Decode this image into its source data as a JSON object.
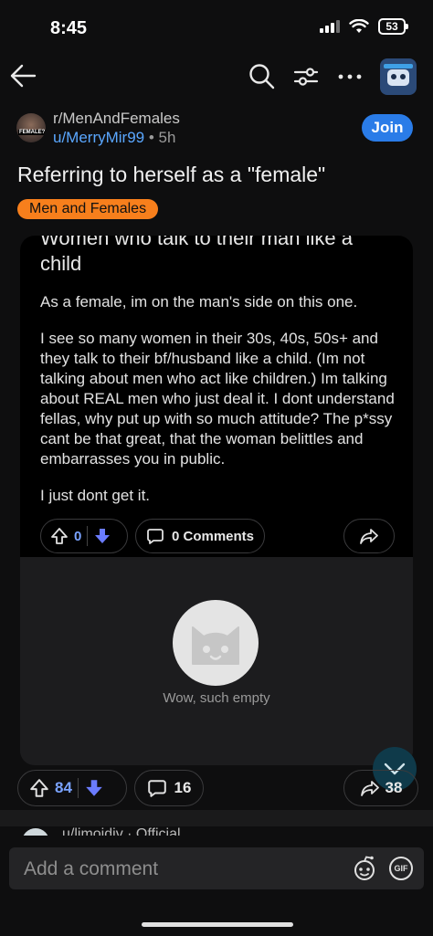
{
  "status_bar": {
    "time": "8:45",
    "battery": "53"
  },
  "nav": {
    "back_icon": "arrow-left-icon",
    "search_icon": "search-icon",
    "filter_icon": "sort-filter-icon",
    "more_icon": "more-horizontal-icon",
    "avatar_icon": "user-avatar"
  },
  "post": {
    "subreddit": "r/MenAndFemales",
    "author": "u/MerryMir99",
    "separator": "•",
    "time_ago": "5h",
    "join_label": "Join",
    "title": "Referring to herself as a \"female\"",
    "flair": "Men and Females",
    "flair_color": "#f77f1c",
    "upvotes": "84",
    "comments": "16",
    "shares": "38"
  },
  "crosspost": {
    "title_cut": "Women who talk to their man like a",
    "title_tail": "child",
    "body": [
      "As a female, im on the man's side on this one.",
      "I see so many women in their 30s, 40s, 50s+ and they talk to their bf/husband like a child. (Im not talking about men who act like children.) Im talking about REAL men who just deal it. I dont understand fellas, why put up with so much attitude? The p*ssy cant be that great, that the woman belittles and embarrasses you in public.",
      "I just dont get it."
    ],
    "votes": "0",
    "comments_label": "0 Comments",
    "empty_text": "Wow, such empty"
  },
  "next_comment": {
    "text": "u/limoidiv · Official"
  },
  "comment_bar": {
    "placeholder": "Add a comment",
    "gif_label": "GIF"
  },
  "colors": {
    "accent": "#2a7ce8",
    "link": "#5aa7ff",
    "downvote": "#6b7cff"
  }
}
